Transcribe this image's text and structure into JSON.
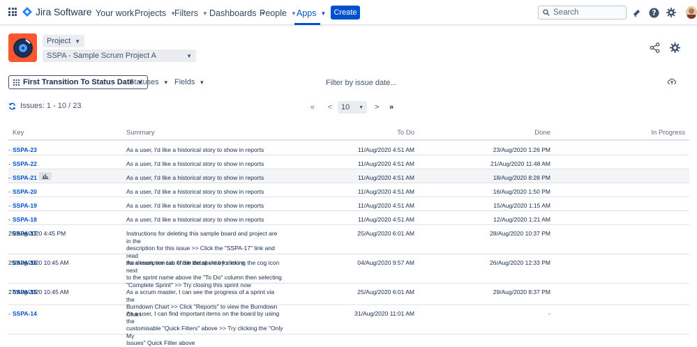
{
  "nav": {
    "brand": "Jira Software",
    "items": [
      {
        "label": "Your work",
        "dropdown": false
      },
      {
        "label": "Projects",
        "dropdown": true
      },
      {
        "label": "Filters",
        "dropdown": true
      },
      {
        "label": "Dashboards",
        "dropdown": true
      },
      {
        "label": "People",
        "dropdown": true
      },
      {
        "label": "Apps",
        "dropdown": true,
        "active": true
      }
    ],
    "create_label": "Create",
    "search_placeholder": "Search"
  },
  "header": {
    "project_button": "Project",
    "project_select": "SSPA - Sample Scrum Project A"
  },
  "filterbar": {
    "report_type": "First Transition To Status Date",
    "statuses": "Statuses",
    "fields": "Fields",
    "filter_date": "Filter by issue date..."
  },
  "pagination": {
    "issues_label": "Issues: 1 - 10 / 23",
    "first": "«",
    "prev": "<",
    "page_size": "10",
    "next": ">",
    "last": "»"
  },
  "table": {
    "columns": [
      "Key",
      "Summary",
      "To Do",
      "Done",
      "In Progress"
    ],
    "rows": [
      {
        "key": "SSPA-23",
        "summary": [
          "As a user, I'd like a historical story to show in reports"
        ],
        "todo": "11/Aug/2020 4:51 AM",
        "done": "23/Aug/2020 1:26 PM",
        "inprogress": "-"
      },
      {
        "key": "SSPA-22",
        "summary": [
          "As a user, I'd like a historical story to show in reports"
        ],
        "todo": "11/Aug/2020 4:51 AM",
        "done": "21/Aug/2020 11:48 AM",
        "inprogress": "-"
      },
      {
        "key": "SSPA-21",
        "summary": [
          "As a user, I'd like a historical story to show in reports"
        ],
        "todo": "11/Aug/2020 4:51 AM",
        "done": "18/Aug/2020 8:28 PM",
        "inprogress": "-",
        "hover": true
      },
      {
        "key": "SSPA-20",
        "summary": [
          "As a user, I'd like a historical story to show in reports"
        ],
        "todo": "11/Aug/2020 4:51 AM",
        "done": "16/Aug/2020 1:50 PM",
        "inprogress": "-"
      },
      {
        "key": "SSPA-19",
        "summary": [
          "As a user, I'd like a historical story to show in reports"
        ],
        "todo": "11/Aug/2020 4:51 AM",
        "done": "15/Aug/2020 1:15 AM",
        "inprogress": "-"
      },
      {
        "key": "SSPA-18",
        "summary": [
          "As a user, I'd like a historical story to show in reports"
        ],
        "todo": "11/Aug/2020 4:51 AM",
        "done": "12/Aug/2020 1:21 AM",
        "inprogress": "-"
      },
      {
        "key": "SSPA-17",
        "summary": [
          "Instructions for deleting this sample board and project are in the",
          "description for this issue >> Click the \"SSPA-17\" link and read",
          "the description tab of the detail view for more"
        ],
        "todo": "25/Aug/2020 6:01 AM",
        "done": "28/Aug/2020 10:37 PM",
        "inprogress": "25/Aug/2020 4:45 PM"
      },
      {
        "key": "SSPA-16",
        "summary": [
          "As a team, we can finish the sprint by clicking the cog icon next",
          "to the sprint name above the \"To Do\" column then selecting",
          "\"Complete Sprint\" >> Try closing this sprint now"
        ],
        "todo": "04/Aug/2020 9:57 AM",
        "done": "26/Aug/2020 12:33 PM",
        "inprogress": "25/Aug/2020 10:45 AM"
      },
      {
        "key": "SSPA-15",
        "summary": [
          "As a scrum master, I can see the progress of a sprint via the",
          "Burndown Chart >> Click \"Reports\" to view the Burndown Chart"
        ],
        "todo": "25/Aug/2020 6:01 AM",
        "done": "29/Aug/2020 8:37 PM",
        "inprogress": "27/Aug/2020 10:45 AM"
      },
      {
        "key": "SSPA-14",
        "summary": [
          "As a user, I can find important items on the board by using the",
          "customisable \"Quick Filters\" above >> Try clicking the \"Only My",
          "Issues\" Quick Filter above"
        ],
        "todo": "31/Aug/2020 11:01 AM",
        "done": "-",
        "inprogress": "-"
      }
    ]
  }
}
